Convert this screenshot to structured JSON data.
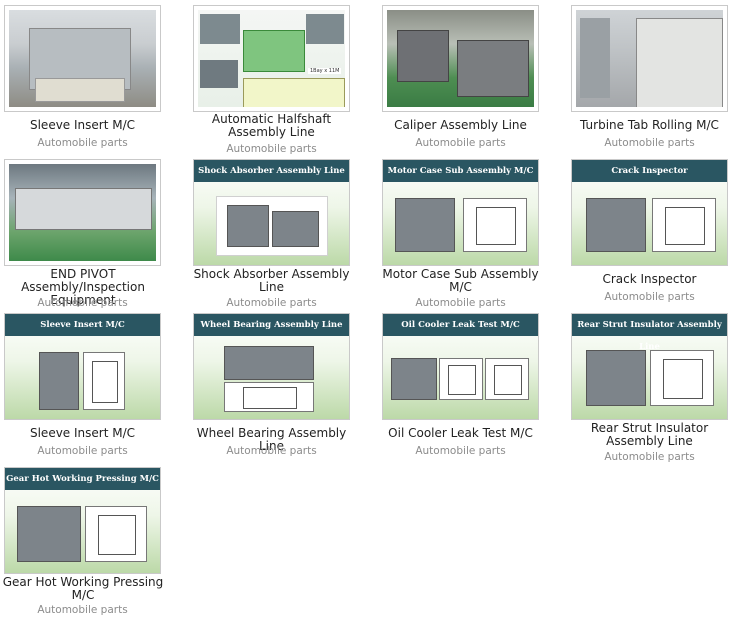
{
  "items": [
    {
      "title": "Sleeve Insert M/C",
      "category": "Automobile parts",
      "thumb_style": "photo",
      "caption": ""
    },
    {
      "title": "Automatic Halfshaft Assembly Line",
      "category": "Automobile parts",
      "thumb_style": "doc",
      "caption": ""
    },
    {
      "title": "Caliper Assembly Line",
      "category": "Automobile parts",
      "thumb_style": "photo",
      "caption": ""
    },
    {
      "title": "Turbine Tab Rolling M/C",
      "category": "Automobile parts",
      "thumb_style": "photo",
      "caption": ""
    },
    {
      "title": "END PIVOT Assembly/Inspection Equipment",
      "category": "Automobile parts",
      "thumb_style": "photo",
      "caption": ""
    },
    {
      "title": "Shock Absorber Assembly Line",
      "category": "Automobile parts",
      "thumb_style": "card",
      "caption": "Shock Absorber Assembly Line"
    },
    {
      "title": "Motor Case Sub Assembly M/C",
      "category": "Automobile parts",
      "thumb_style": "card",
      "caption": "Motor Case Sub Assembly M/C"
    },
    {
      "title": "Crack Inspector",
      "category": "Automobile parts",
      "thumb_style": "card",
      "caption": "Crack Inspector"
    },
    {
      "title": "Sleeve Insert M/C",
      "category": "Automobile parts",
      "thumb_style": "card",
      "caption": "Sleeve Insert M/C"
    },
    {
      "title": "Wheel Bearing Assembly Line",
      "category": "Automobile parts",
      "thumb_style": "card",
      "caption": "Wheel Bearing Assembly Line"
    },
    {
      "title": "Oil Cooler Leak Test M/C",
      "category": "Automobile parts",
      "thumb_style": "card",
      "caption": "Oil Cooler Leak Test M/C"
    },
    {
      "title": "Rear Strut Insulator Assembly Line",
      "category": "Automobile parts",
      "thumb_style": "card",
      "caption": "Rear Strut Insulator Assembly Line"
    },
    {
      "title": "Gear Hot Working Pressing M/C",
      "category": "Automobile parts",
      "thumb_style": "card",
      "caption": "Gear Hot Working Pressing M/C"
    }
  ],
  "doc_thumb": {
    "badge": "1Bay x 11M"
  },
  "colors": {
    "card_band": "#2a5662",
    "category_text": "#8c8c8c",
    "thumb_border": "#c9c9c9"
  }
}
